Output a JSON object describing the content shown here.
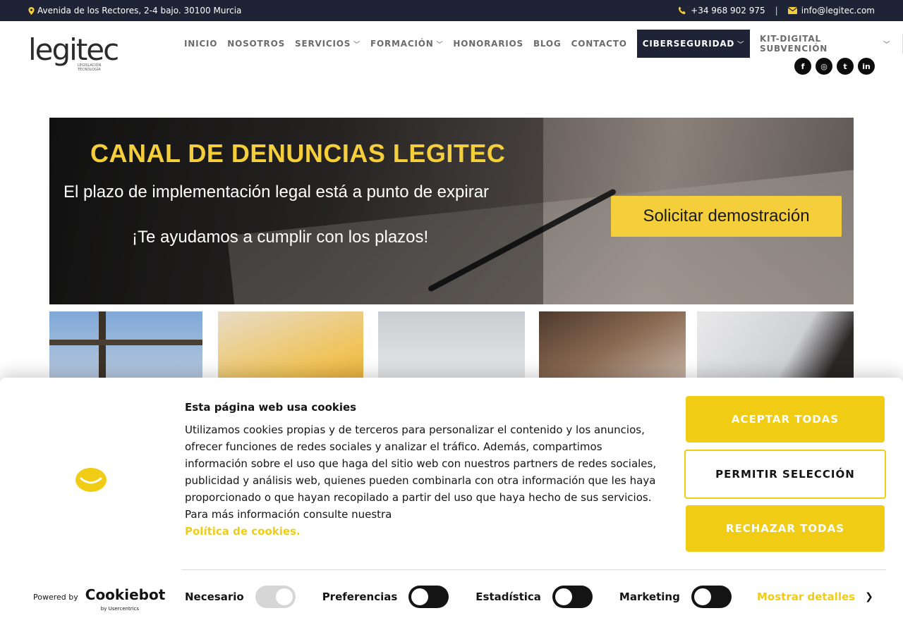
{
  "topbar": {
    "address": "Avenida de los Rectores, 2-4 bajo. 30100 Murcia",
    "phone": "+34 968 902 975",
    "separator": "|",
    "email": "info@legitec.com"
  },
  "logo": {
    "word": "legitec",
    "tagline_line1": "LEGISLACIÓN",
    "tagline_line2": "TECNOLOGÍA"
  },
  "nav": {
    "items": [
      {
        "label": "INICIO"
      },
      {
        "label": "NOSOTROS"
      },
      {
        "label": "SERVICIOS"
      },
      {
        "label": "FORMACIÓN"
      },
      {
        "label": "HONORARIOS"
      },
      {
        "label": "BLOG"
      },
      {
        "label": "CONTACTO"
      },
      {
        "label": "CIBERSEGURIDAD"
      },
      {
        "label": "KIT-DIGITAL SUBVENCIÓN"
      }
    ]
  },
  "social": {
    "icons": [
      "facebook-icon",
      "instagram-icon",
      "twitter-icon",
      "linkedin-icon"
    ],
    "glyphs": [
      "f",
      "◎",
      "t",
      "in"
    ]
  },
  "hero": {
    "title": "CANAL DE DENUNCIAS LEGITEC",
    "line1": "El plazo de implementación legal está a punto de expirar",
    "line2": "¡Te ayudamos a cumplir con los plazos!",
    "cta": "Solicitar demostración"
  },
  "cookie": {
    "title": "Esta página web usa cookies",
    "body": "Utilizamos cookies propias y de terceros para personalizar el contenido y los anuncios, ofrecer funciones de redes sociales y analizar el tráfico. Además, compartimos información sobre el uso que haga del sitio web con nuestros partners de redes sociales, publicidad y análisis web, quienes pueden combinarla con otra información que les haya proporcionado o que hayan recopilado a partir del uso que haya hecho de sus servicios. Para más información consulte nuestra",
    "link": "Política de cookies.",
    "accept": "ACEPTAR TODAS",
    "allow_selection": "PERMITIR SELECCIÓN",
    "reject": "RECHAZAR TODAS",
    "toggles": [
      {
        "label": "Necesario",
        "on": true
      },
      {
        "label": "Preferencias",
        "on": false
      },
      {
        "label": "Estadística",
        "on": false
      },
      {
        "label": "Marketing",
        "on": false
      }
    ],
    "show_details": "Mostrar detalles",
    "powered_by": "Powered by",
    "brand": "Cookiebot",
    "brand_sub": "by Usercentrics"
  },
  "colors": {
    "accent": "#f0cc14",
    "hero_title": "#f5cf3b",
    "dark": "#1e2435"
  }
}
